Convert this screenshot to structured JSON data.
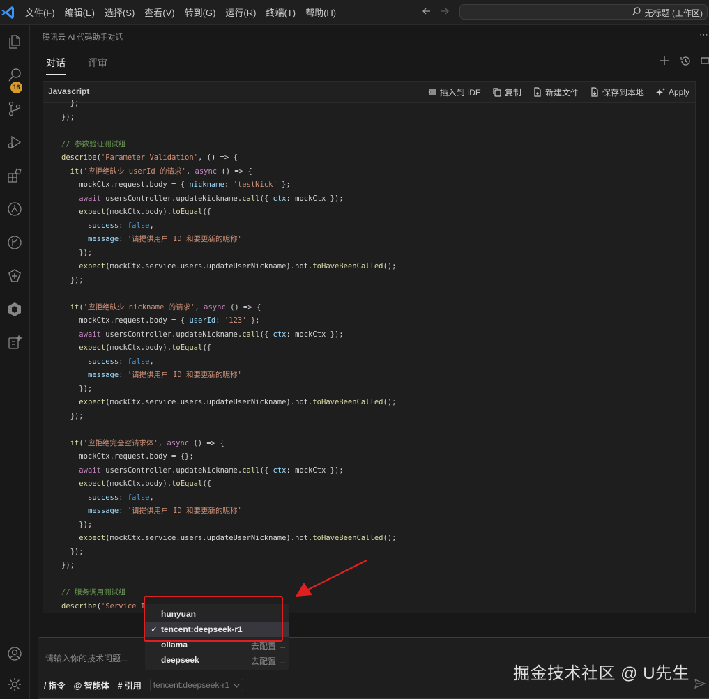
{
  "titlebar": {
    "menu": [
      "文件(F)",
      "编辑(E)",
      "选择(S)",
      "查看(V)",
      "转到(G)",
      "运行(R)",
      "终端(T)",
      "帮助(H)"
    ],
    "search_text": "无标题 (工作区)"
  },
  "activity": {
    "scm_badge": "16"
  },
  "panel": {
    "title": "腾讯云 AI 代码助手对话",
    "tabs": [
      "对话",
      "评审"
    ]
  },
  "codeblock": {
    "language": "Javascript",
    "actions": [
      "插入到 IDE",
      "复制",
      "新建文件",
      "保存到本地",
      "Apply"
    ]
  },
  "dropdown": {
    "items": [
      {
        "label": "hunyuan",
        "config": ""
      },
      {
        "label": "tencent:deepseek-r1",
        "config": "",
        "selected": true
      },
      {
        "label": "ollama",
        "config": "去配置 →"
      },
      {
        "label": "deepseek",
        "config": "去配置 →"
      }
    ],
    "check_mark": "✓"
  },
  "input": {
    "placeholder": "请输入你的技术问题...",
    "commands": [
      "/ 指令",
      "@ 智能体",
      "# 引用"
    ],
    "model": "tencent:deepseek-r1"
  },
  "watermark": "掘金技术社区 @ U先生",
  "colors": {
    "accent_badge": "#d89b27",
    "highlight_box": "#e02020",
    "vscode_blue": "#3794ff"
  }
}
